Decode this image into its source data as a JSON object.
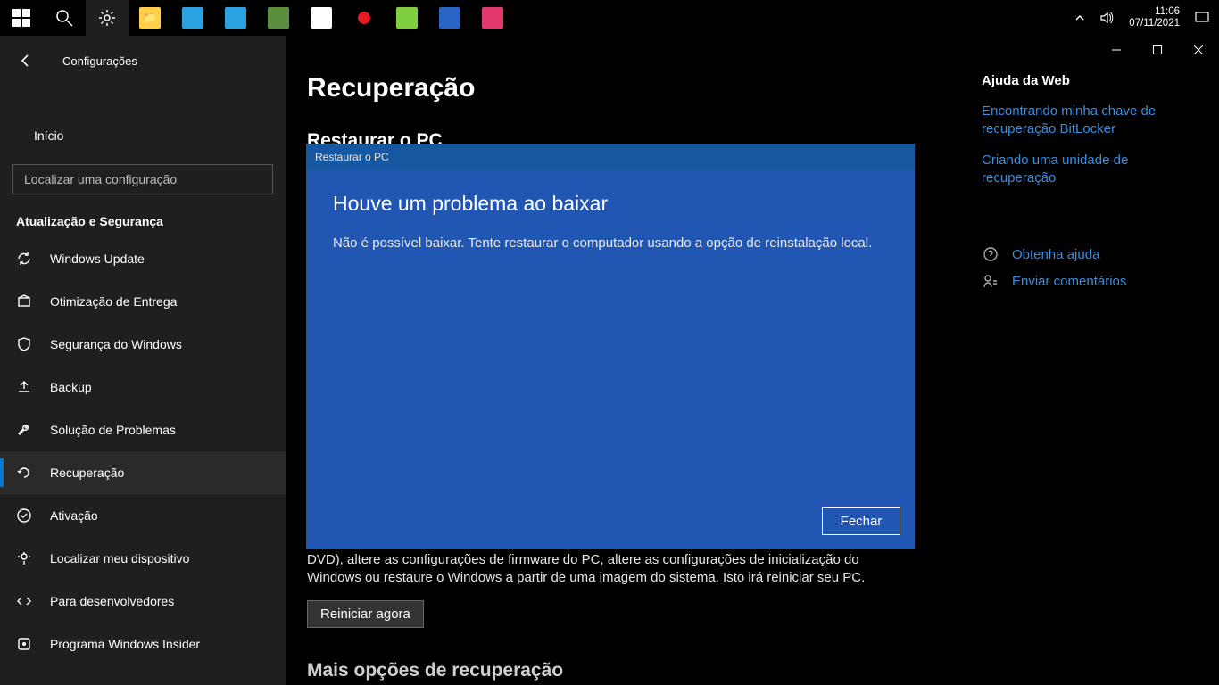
{
  "taskbar": {
    "time": "11:06",
    "date": "07/11/2021"
  },
  "window": {
    "title": "Configurações"
  },
  "sidebar": {
    "home": "Início",
    "search_placeholder": "Localizar uma configuração",
    "section": "Atualização e Segurança",
    "items": [
      {
        "label": "Windows Update"
      },
      {
        "label": "Otimização de Entrega"
      },
      {
        "label": "Segurança do Windows"
      },
      {
        "label": "Backup"
      },
      {
        "label": "Solução de Problemas"
      },
      {
        "label": "Recuperação"
      },
      {
        "label": "Ativação"
      },
      {
        "label": "Localizar meu dispositivo"
      },
      {
        "label": "Para desenvolvedores"
      },
      {
        "label": "Programa Windows Insider"
      }
    ]
  },
  "main": {
    "title": "Recuperação",
    "section1_head": "Restaurar o PC",
    "advanced_text": "DVD), altere as configurações de firmware do PC, altere as configurações de inicialização do Windows ou restaure o Windows a partir de uma imagem do sistema. Isto irá reiniciar seu PC.",
    "restart_btn": "Reiniciar agora",
    "more_head": "Mais opções de recuperação"
  },
  "right": {
    "head": "Ajuda da Web",
    "link1": "Encontrando minha chave de recuperação BitLocker",
    "link2": "Criando uma unidade de recuperação",
    "help": "Obtenha ajuda",
    "feedback": "Enviar comentários"
  },
  "modal": {
    "title": "Restaurar o PC",
    "heading": "Houve um problema ao baixar",
    "message": "Não é possível baixar. Tente restaurar o computador usando a opção de reinstalação local.",
    "close": "Fechar"
  }
}
